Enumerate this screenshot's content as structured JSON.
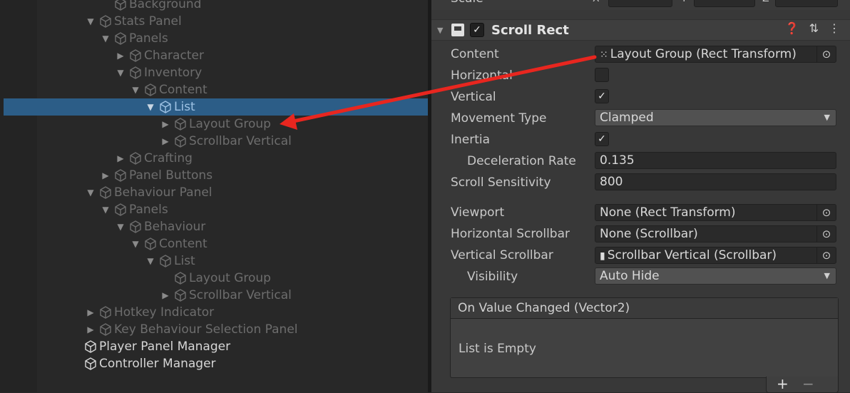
{
  "hierarchy": {
    "rows": [
      {
        "label": "Background",
        "indent": 1,
        "arrow": "",
        "state": "dim"
      },
      {
        "label": "Stats Panel",
        "indent": 0,
        "arrow": "▼",
        "state": "dim"
      },
      {
        "label": "Panels",
        "indent": 1,
        "arrow": "▼",
        "state": "dim"
      },
      {
        "label": "Character",
        "indent": 2,
        "arrow": "▶",
        "state": "dim"
      },
      {
        "label": "Inventory",
        "indent": 2,
        "arrow": "▼",
        "state": "dim"
      },
      {
        "label": "Content",
        "indent": 3,
        "arrow": "▼",
        "state": "dim"
      },
      {
        "label": "List",
        "indent": 4,
        "arrow": "▼",
        "state": "selected"
      },
      {
        "label": "Layout Group",
        "indent": 5,
        "arrow": "▶",
        "state": "dim"
      },
      {
        "label": "Scrollbar Vertical",
        "indent": 5,
        "arrow": "▶",
        "state": "dim"
      },
      {
        "label": "Crafting",
        "indent": 2,
        "arrow": "▶",
        "state": "dim"
      },
      {
        "label": "Panel Buttons",
        "indent": 1,
        "arrow": "▶",
        "state": "dim"
      },
      {
        "label": "Behaviour Panel",
        "indent": 0,
        "arrow": "▼",
        "state": "dim"
      },
      {
        "label": "Panels",
        "indent": 1,
        "arrow": "▼",
        "state": "dim"
      },
      {
        "label": "Behaviour",
        "indent": 2,
        "arrow": "▼",
        "state": "dim"
      },
      {
        "label": "Content",
        "indent": 3,
        "arrow": "▼",
        "state": "dim"
      },
      {
        "label": "List",
        "indent": 4,
        "arrow": "▼",
        "state": "dim"
      },
      {
        "label": "Layout Group",
        "indent": 5,
        "arrow": "",
        "state": "dim"
      },
      {
        "label": "Scrollbar Vertical",
        "indent": 5,
        "arrow": "▶",
        "state": "dim"
      },
      {
        "label": "Hotkey Indicator",
        "indent": 0,
        "arrow": "▶",
        "state": "dim"
      },
      {
        "label": "Key Behaviour Selection Panel",
        "indent": 0,
        "arrow": "▶",
        "state": "dim"
      },
      {
        "label": "Player Panel Manager",
        "indent": -1,
        "arrow": "",
        "state": "active"
      },
      {
        "label": "Controller Manager",
        "indent": -1,
        "arrow": "",
        "state": "active"
      }
    ]
  },
  "inspector": {
    "top_label": "Scale",
    "component": {
      "title": "Scroll Rect",
      "enabled_mark": "✓",
      "icons": [
        "help-icon",
        "preset-icon",
        "kebab-menu-icon"
      ]
    },
    "properties": {
      "content": {
        "label": "Content",
        "value": "Layout Group (Rect Transform)"
      },
      "horizontal": {
        "label": "Horizontal",
        "checked": false
      },
      "vertical": {
        "label": "Vertical",
        "checked": true
      },
      "movement_type": {
        "label": "Movement Type",
        "value": "Clamped"
      },
      "inertia": {
        "label": "Inertia",
        "checked": true
      },
      "deceleration_rate": {
        "label": "Deceleration Rate",
        "value": "0.135"
      },
      "scroll_sensitivity": {
        "label": "Scroll Sensitivity",
        "value": "800"
      },
      "viewport": {
        "label": "Viewport",
        "value": "None (Rect Transform)"
      },
      "horizontal_scrollbar": {
        "label": "Horizontal Scrollbar",
        "value": "None (Scrollbar)"
      },
      "vertical_scrollbar": {
        "label": "Vertical Scrollbar",
        "value": "Scrollbar Vertical (Scrollbar)"
      },
      "visibility": {
        "label": "Visibility",
        "value": "Auto Hide"
      }
    },
    "event": {
      "title": "On Value Changed (Vector2)",
      "empty_text": "List is Empty",
      "add": "+",
      "remove": "−"
    },
    "check_mark": "✓"
  },
  "annotation": {
    "arrow_color": "#e8261f"
  }
}
